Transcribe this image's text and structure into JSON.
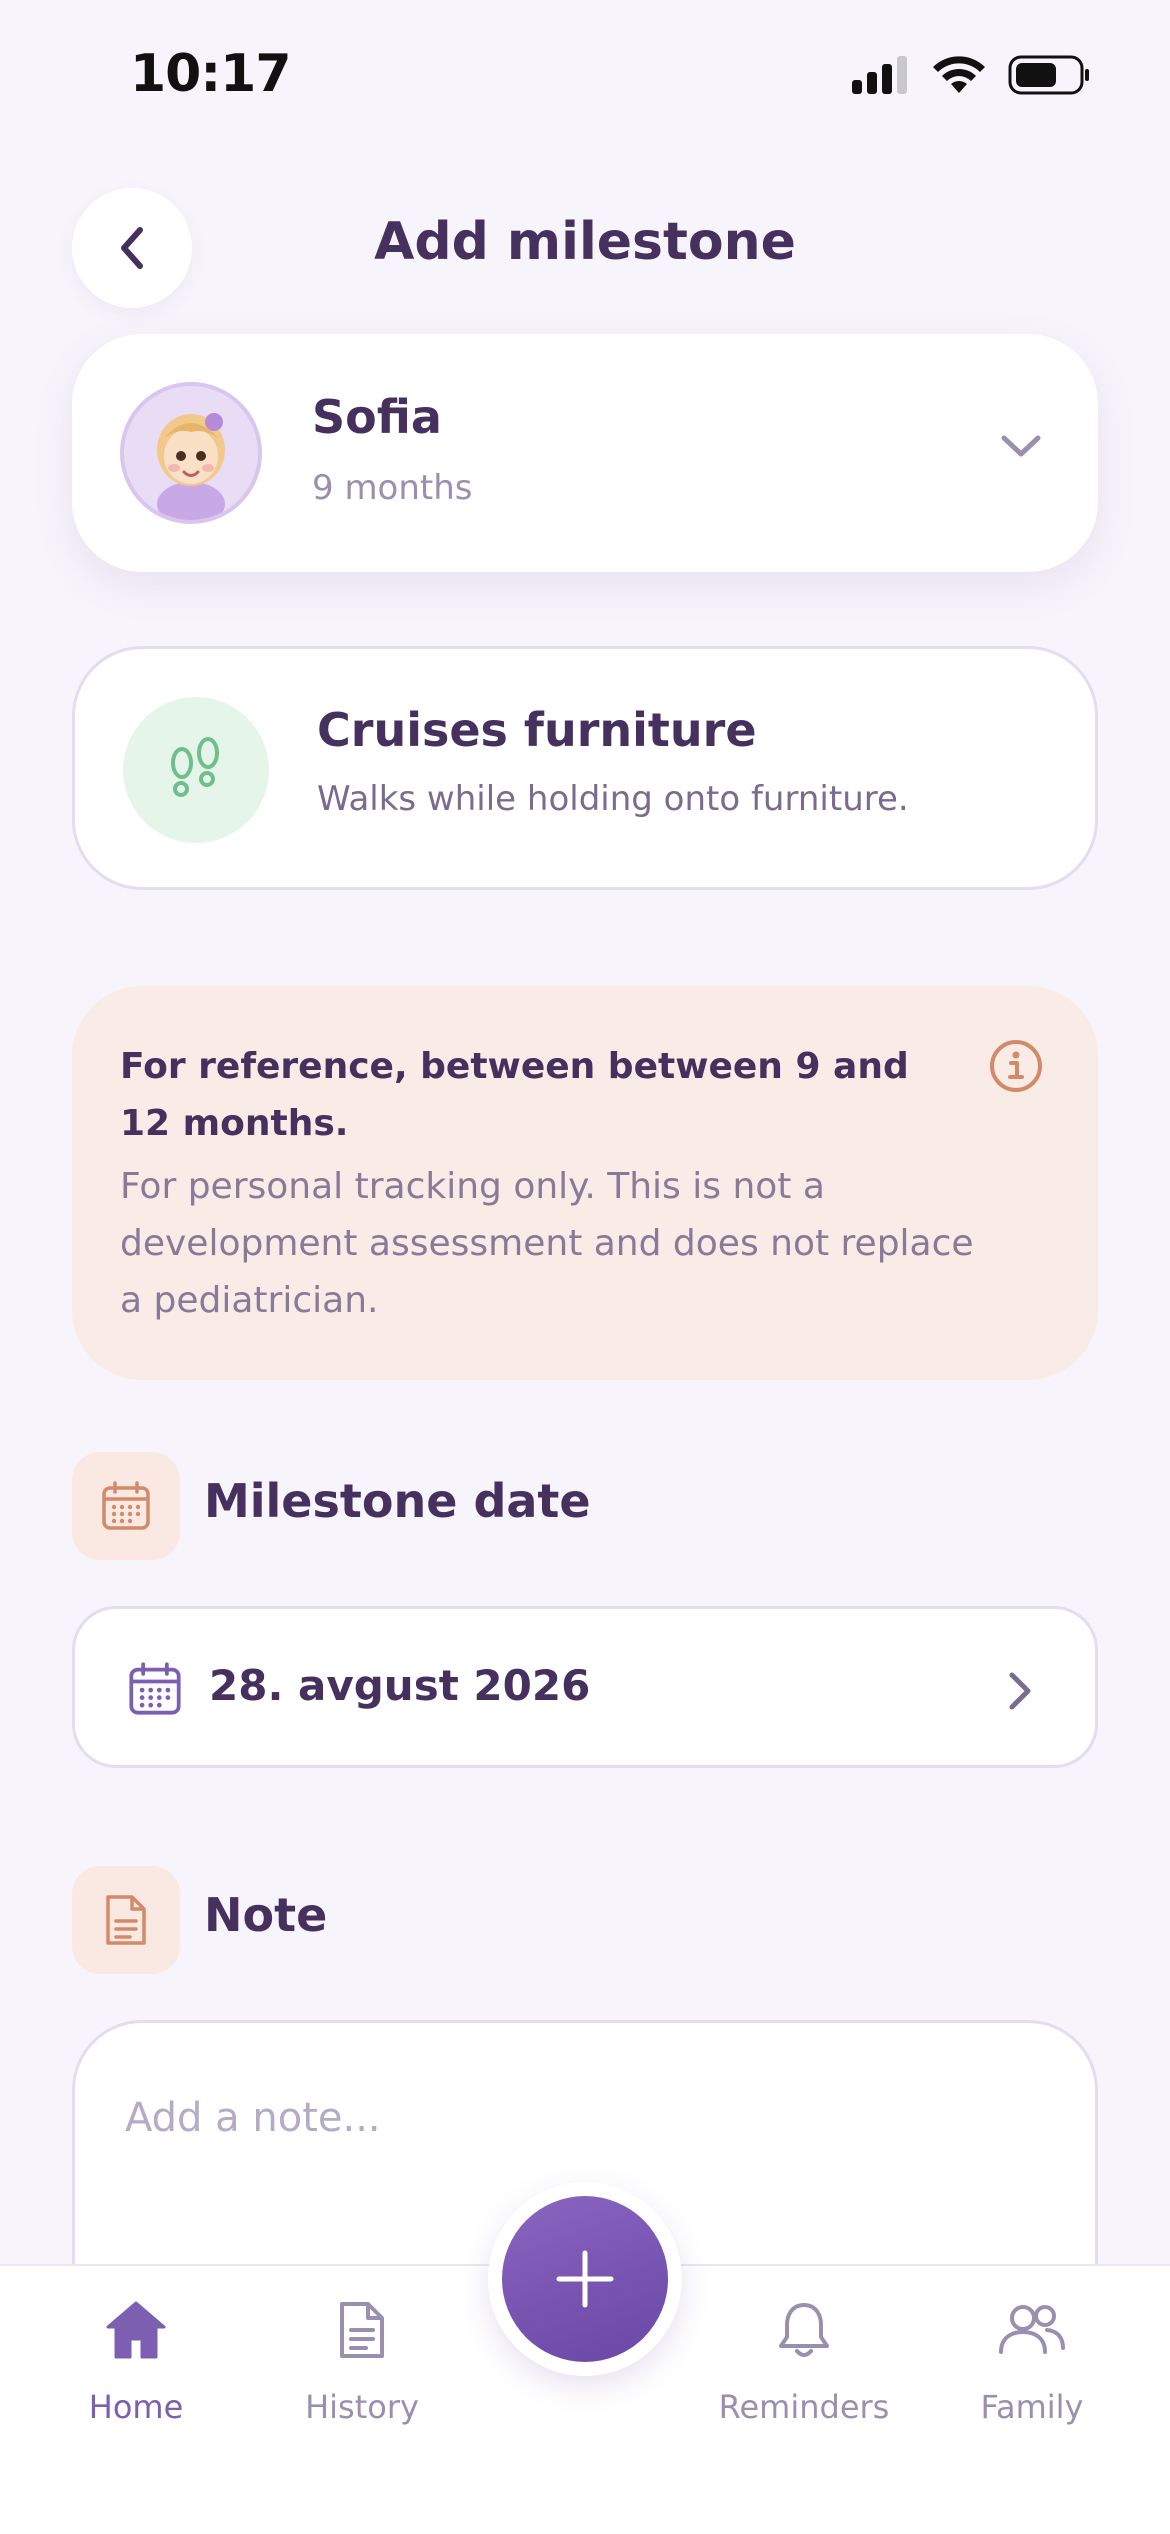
{
  "status_bar": {
    "time": "10:17"
  },
  "header": {
    "title": "Add milestone"
  },
  "child": {
    "name": "Sofia",
    "age": "9 months"
  },
  "milestone": {
    "title": "Cruises furniture",
    "description": "Walks while holding onto furniture."
  },
  "reference": {
    "main": "For reference, between between 9 and 12 months.",
    "sub": "For personal tracking only. This is not a development assessment and does not replace a pediatrician."
  },
  "date_section": {
    "title": "Milestone date",
    "value": "28. avgust 2026"
  },
  "note_section": {
    "title": "Note",
    "placeholder": "Add a note..."
  },
  "tabbar": {
    "items": [
      {
        "label": "Home",
        "icon": "home-icon",
        "active": true
      },
      {
        "label": "History",
        "icon": "document-icon",
        "active": false
      },
      {
        "label": "Reminders",
        "icon": "bell-icon",
        "active": false
      },
      {
        "label": "Family",
        "icon": "people-icon",
        "active": false
      }
    ],
    "fab_icon": "plus-icon"
  },
  "colors": {
    "accent": "#7c5fb0",
    "text": "#45305e",
    "notice_bg": "#f9ebe6",
    "milestone_icon_bg": "#e5f5ea"
  }
}
